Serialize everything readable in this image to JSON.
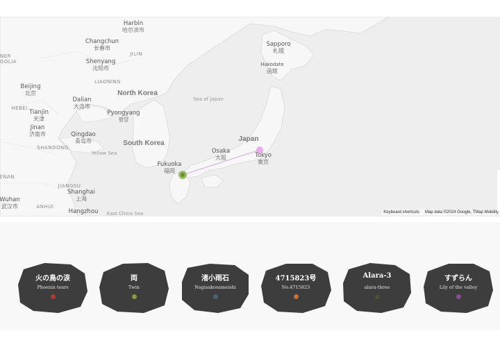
{
  "map": {
    "labels": {
      "harbin": {
        "en": "Harbin",
        "local": "哈尔滨市"
      },
      "changchun": {
        "en": "Changchun",
        "local": "长春市"
      },
      "jilin": {
        "en": "JILIN"
      },
      "shenyang": {
        "en": "Shenyang",
        "local": "沈阳市"
      },
      "liaoning": {
        "en": "LIAONING"
      },
      "ner": {
        "en": "NER"
      },
      "golia": {
        "en": "GOLIA"
      },
      "beijing": {
        "en": "Beijing",
        "local": "北京"
      },
      "dalian": {
        "en": "Dalian",
        "local": "大连市"
      },
      "north_korea": {
        "en": "North Korea"
      },
      "pyongyang": {
        "en": "Pyongyang",
        "local": "평양"
      },
      "hebei": {
        "en": "HEBEI"
      },
      "tianjin": {
        "en": "Tianjin",
        "local": "天津"
      },
      "jinan": {
        "en": "Jinan",
        "local": "济南市"
      },
      "qingdao": {
        "en": "Qingdao",
        "local": "青岛市"
      },
      "shandong": {
        "en": "SHANDONG"
      },
      "yellow_sea": {
        "en": "Yellow Sea"
      },
      "south_korea": {
        "en": "South Korea"
      },
      "sea_of_japan": {
        "en": "Sea of Japan"
      },
      "sapporo": {
        "en": "Sapporo",
        "local": "札幌"
      },
      "hakodate": {
        "en": "Hakodate",
        "local": "函館"
      },
      "japan": {
        "en": "Japan"
      },
      "osaka": {
        "en": "Osaka",
        "local": "大阪"
      },
      "tokyo": {
        "en": "Tokyo",
        "local": "東京"
      },
      "fukuoka": {
        "en": "Fukuoka",
        "local": "福岡"
      },
      "henan": {
        "en": "ENAN"
      },
      "jiangsu": {
        "en": "JIANGSU"
      },
      "shanghai": {
        "en": "Shanghai",
        "local": "上海"
      },
      "wuhan": {
        "en": "Wuhan",
        "local": "武汉市"
      },
      "anhui": {
        "en": "ANHUI"
      },
      "hangzhou": {
        "en": "Hangzhou"
      },
      "east_china_sea": {
        "en": "East China Sea"
      }
    },
    "attribution": {
      "shortcuts": "Keyboard shortcuts",
      "data": "Map data ©2024 Google, TMap Mobility"
    },
    "colors": {
      "fukuoka_marker": "#8bb14a",
      "tokyo_marker": "#e39be8",
      "route_line": "#d9a6e6"
    }
  },
  "cards": [
    {
      "name": "火の鳥の涙",
      "sub": "Phoenix tears",
      "dot_color": "#b23a2e"
    },
    {
      "name": "両",
      "sub": "Twin",
      "dot_color": "#8a9640"
    },
    {
      "name": "渚小雨石",
      "sub": "Nagisakosameishi",
      "dot_color": "#4b6475"
    },
    {
      "name": "4715823号",
      "sub": "No.4715823",
      "dot_color": "#c87038"
    },
    {
      "name": "Alara-3",
      "sub": "alara-three",
      "dot_color": "#4a5232"
    },
    {
      "name": "すずらん",
      "sub": "Lily of the valley",
      "dot_color": "#8e4a8e"
    }
  ]
}
